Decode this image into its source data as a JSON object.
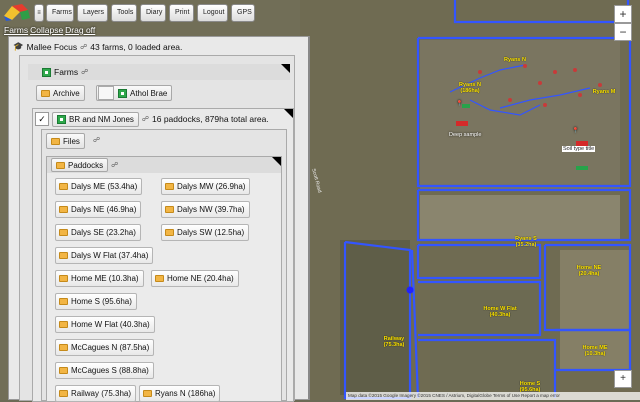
{
  "toolbar": {
    "buttons": [
      "Farms",
      "Layers",
      "Tools",
      "Diary",
      "Print",
      "Logout",
      "GPS"
    ]
  },
  "nav_links": [
    "Farms",
    "Collapse",
    "Drag off"
  ],
  "focus": {
    "name": "Mallee Focus",
    "summary": "43 farms, 0 loaded area."
  },
  "farms": {
    "title": "Farms",
    "archive": "Archive",
    "farm_name": "Athol Brae"
  },
  "client": {
    "name": "BR and NM Jones",
    "summary": "16 paddocks, 879ha total area."
  },
  "files": {
    "title": "Files"
  },
  "paddocks": {
    "title": "Paddocks",
    "items": [
      "Dalys ME (53.4ha)",
      "Dalys MW (26.9ha)",
      "Dalys NE (46.9ha)",
      "Dalys NW (39.7ha)",
      "Dalys SE (23.2ha)",
      "Dalys SW (12.5ha)",
      "Dalys W Flat (37.4ha)",
      "Home ME (10.3ha)",
      "Home NE (20.4ha)",
      "Home S (95.6ha)",
      "Home W Flat (40.3ha)",
      "McCagues N (87.5ha)",
      "McCagues S (88.8ha)",
      "Railway (75.3ha)",
      "Ryans N (186ha)"
    ]
  },
  "map": {
    "zoom_in": "+",
    "zoom_out": "−",
    "road_label": "Scott Road",
    "labels": [
      "Ryans N (186ha)",
      "Ryans N",
      "Ryans M",
      "Deep sample",
      "Soil type title",
      "Ryans S (35.2ha)",
      "Home NE (20.4ha)",
      "Home W Flat (40.3ha)",
      "Railway (75.3ha)",
      "Home ME (10.3ha)",
      "Home S (95.6ha)"
    ],
    "attribution": "Map data ©2015 Google Imagery ©2015 CNES / Astrium, DigitalGlobe   Terms of Use   Report a map error"
  },
  "colors": {
    "boundary": "#3355ff",
    "label": "#ffe600",
    "marker": "#d42a2a",
    "panel": "#e9e9e9"
  },
  "icons": {
    "focus": "graduation-cap-icon",
    "paddock": "field-icon",
    "files": "folder-icon"
  }
}
